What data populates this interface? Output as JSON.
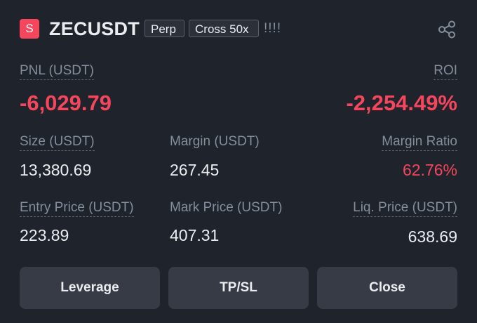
{
  "header": {
    "side_badge": "S",
    "symbol": "ZECUSDT",
    "contract_type": "Perp",
    "margin_mode": "Cross 50x",
    "marks": "!!!!",
    "share_icon": "share-icon"
  },
  "pnl": {
    "label": "PNL (USDT)",
    "value": "-6,029.79"
  },
  "roi": {
    "label": "ROI",
    "value": "-2,254.49%"
  },
  "size": {
    "label": "Size (USDT)",
    "value": "13,380.69"
  },
  "margin": {
    "label": "Margin (USDT)",
    "value": "267.45"
  },
  "margin_ratio": {
    "label": "Margin Ratio",
    "value": "62.76%"
  },
  "entry_price": {
    "label": "Entry Price (USDT)",
    "value": "223.89"
  },
  "mark_price": {
    "label": "Mark Price (USDT)",
    "value": "407.31"
  },
  "liq_price": {
    "label": "Liq. Price (USDT)",
    "value": "638.69"
  },
  "actions": {
    "leverage": "Leverage",
    "tpsl": "TP/SL",
    "close": "Close"
  },
  "colors": {
    "loss": "#f6465d",
    "background": "#1f232b",
    "button": "#363b45",
    "muted": "#848e9c"
  }
}
